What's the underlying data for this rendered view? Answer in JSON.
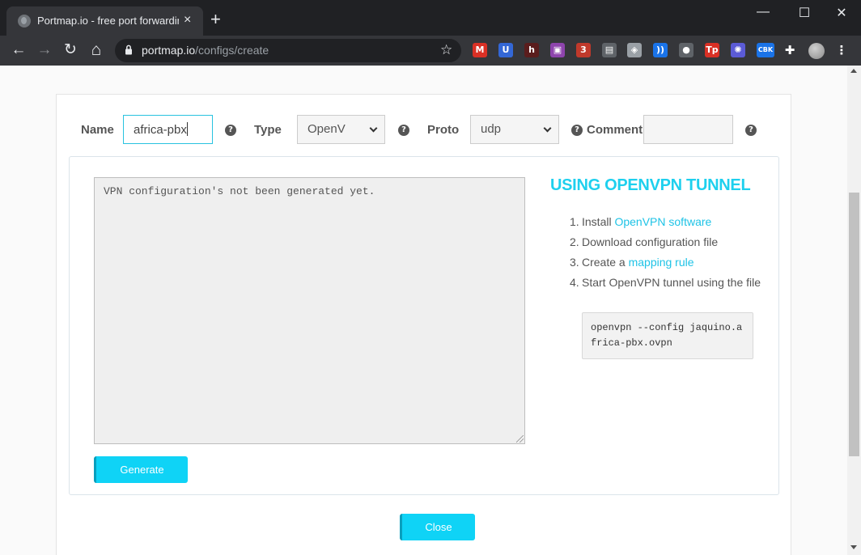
{
  "browser": {
    "tab_title": "Portmap.io - free port forwarding",
    "tab_close": "×",
    "new_tab": "+",
    "window_controls": {
      "minimize": "—",
      "maximize": "☐",
      "close": "✕"
    },
    "nav": {
      "back": "←",
      "forward": "→",
      "reload": "↻",
      "home": "⌂"
    },
    "url_host": "portmap.io",
    "url_path": "/configs/create",
    "star": "☆",
    "extensions": [
      {
        "name": "gmail-icon",
        "label": "M",
        "color": "#d93025"
      },
      {
        "name": "shield-u-icon",
        "label": "U",
        "color": "#3367d6"
      },
      {
        "name": "h-extension-icon",
        "label": "h",
        "color": "#5a1d1d"
      },
      {
        "name": "image-extension-icon",
        "label": "▣",
        "color": "#8e44ad"
      },
      {
        "name": "badge-3-extension-icon",
        "label": "3",
        "color": "#c0392b"
      },
      {
        "name": "reader-icon",
        "label": "▤",
        "color": "#5f6368"
      },
      {
        "name": "shield-icon",
        "label": "◈",
        "color": "#9aa0a6"
      },
      {
        "name": "wave-icon",
        "label": "))",
        "color": "#1a73e8"
      },
      {
        "name": "dots-extension-icon",
        "label": "●",
        "color": "#5f6368"
      },
      {
        "name": "tp-extension-icon",
        "label": "Tp",
        "color": "#d93025"
      },
      {
        "name": "gear-flower-icon",
        "label": "✺",
        "color": "#5b5bd6"
      },
      {
        "name": "cbk-extension-icon",
        "label": "CBK",
        "color": "#1a73e8"
      },
      {
        "name": "puzzle-icon",
        "label": "✚",
        "color": "#35363a"
      },
      {
        "name": "profile-avatar",
        "label": "",
        "color": "#9e9e9e"
      },
      {
        "name": "menu-kebab-icon",
        "label": "⋮",
        "color": "#35363a"
      }
    ]
  },
  "form": {
    "name_label": "Name",
    "name_value": "africa-pbx",
    "type_label": "Type",
    "type_value": "OpenV",
    "proto_label": "Proto",
    "proto_value": "udp",
    "comment_label": "Comment",
    "comment_value": "",
    "help_glyph": "?"
  },
  "config_text": "VPN configuration's not been generated yet.",
  "generate_label": "Generate",
  "close_label": "Close",
  "sidebar": {
    "title": "USING OPENVPN TUNNEL",
    "steps": [
      {
        "num": "1.",
        "text": "Install ",
        "link": "OpenVPN software"
      },
      {
        "num": "2.",
        "text": "Download configuration file",
        "link": ""
      },
      {
        "num": "3.",
        "text": "Create a ",
        "link": "mapping rule"
      },
      {
        "num": "4.",
        "text": "Start OpenVPN tunnel using the file",
        "link": ""
      }
    ],
    "command": "openvpn --config jaquino.africa-pbx.ovpn"
  }
}
